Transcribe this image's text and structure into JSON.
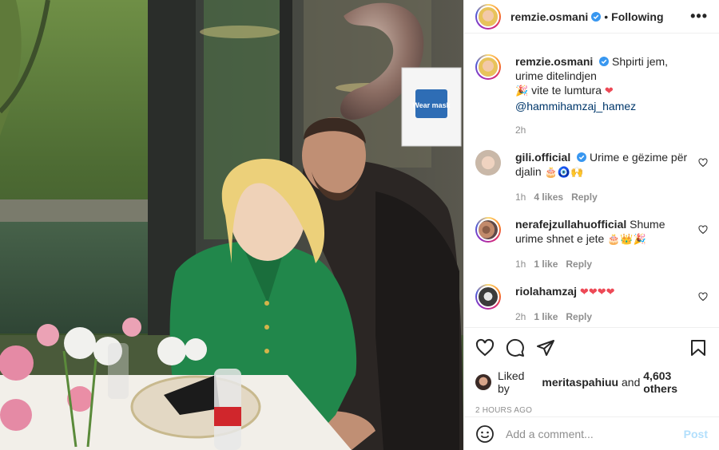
{
  "post": {
    "author": "remzie.osmani",
    "follow_status": "Following",
    "separator": "•",
    "more_label": "•••",
    "caption": {
      "text": "Shpirti jem, urime ditelindjen",
      "line2_emoji": "🎉",
      "line2_text": "vite te lumtura",
      "line2_heart": "❤",
      "mention": "@hammihamzaj_hamez",
      "time": "2h"
    },
    "photo_sign": {
      "title": "Wear mask"
    },
    "comments": [
      {
        "user": "gili.official",
        "verified": true,
        "text": "Urime e gëzime për djalin",
        "emoji": "🎂🧿🙌",
        "time": "1h",
        "likes": "4 likes",
        "reply": "Reply"
      },
      {
        "user": "nerafejzullahuofficial",
        "verified": false,
        "text": "Shume urime shnet e jete",
        "emoji": "🎂👑🎉",
        "time": "1h",
        "likes": "1 like",
        "reply": "Reply"
      },
      {
        "user": "riolahamzaj",
        "verified": false,
        "text": "",
        "emoji": "❤❤❤❤",
        "time": "2h",
        "likes": "1 like",
        "reply": "Reply"
      }
    ],
    "liked_by_prefix": "Liked by",
    "liked_by_user": "meritaspahiuu",
    "liked_by_and": "and",
    "liked_by_others": "4,603 others",
    "time_ago": "2 HOURS AGO",
    "comment_placeholder": "Add a comment...",
    "post_button": "Post"
  },
  "colors": {
    "verified": "#3897f0",
    "link": "#00376b",
    "muted": "#8e8e8e",
    "post_disabled": "#b2dffc"
  },
  "icons": {
    "like": "heart-outline-icon",
    "comment": "comment-bubble-icon",
    "share": "paper-plane-icon",
    "save": "bookmark-icon",
    "emoji": "smiley-icon",
    "more": "ellipsis-icon"
  }
}
